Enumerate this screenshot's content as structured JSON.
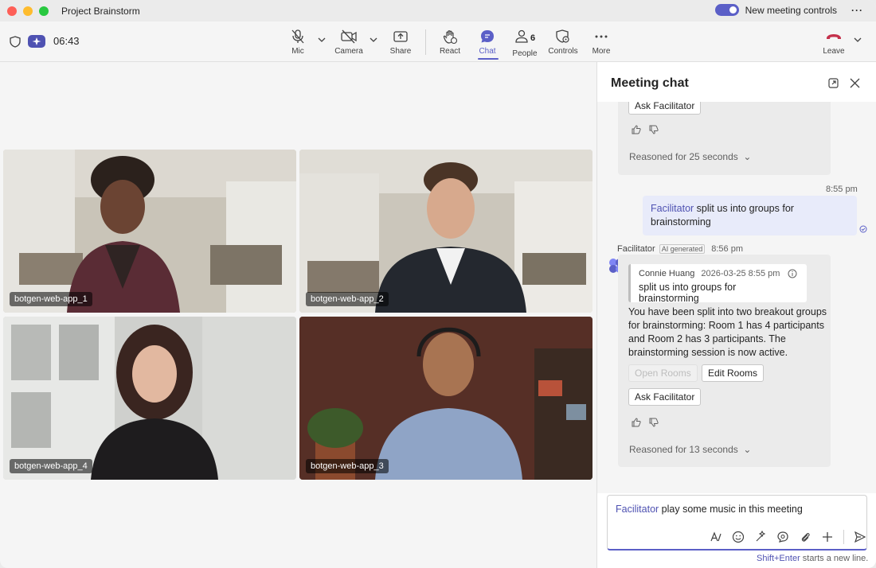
{
  "window": {
    "title": "Project Brainstorm",
    "new_meeting_controls": "New meeting controls"
  },
  "toolbar": {
    "timer": "06:43",
    "mic": "Mic",
    "camera": "Camera",
    "share": "Share",
    "react": "React",
    "chat": "Chat",
    "people": "People",
    "people_count": "6",
    "controls": "Controls",
    "more": "More",
    "leave": "Leave"
  },
  "participants": [
    {
      "name": "botgen-web-app_1"
    },
    {
      "name": "botgen-web-app_2"
    },
    {
      "name": "botgen-web-app_4"
    },
    {
      "name": "botgen-web-app_3"
    }
  ],
  "chat": {
    "title": "Meeting chat",
    "msg1": {
      "ask_facilitator": "Ask Facilitator",
      "reasoned": "Reasoned for 25 seconds"
    },
    "my_message": {
      "time": "8:55 pm",
      "mention": "Facilitator",
      "text": " split us into groups for brainstorming"
    },
    "bot_message": {
      "sender": "Facilitator",
      "ai_tag": "AI generated",
      "time": "8:56 pm",
      "quote_author": "Connie Huang",
      "quote_time": "2026-03-25 8:55 pm",
      "quote_text": "split us into groups for brainstorming",
      "body": "You have been split into two breakout groups for brainstorming: Room 1 has 4 participants and Room 2 has 3 participants. The brainstorming session is now active.",
      "open_rooms": "Open Rooms",
      "edit_rooms": "Edit Rooms",
      "ask_facilitator": "Ask Facilitator",
      "reasoned": "Reasoned for 13 seconds"
    },
    "composer": {
      "mention": "Facilitator",
      "text": " play some music in this meeting"
    },
    "hint_key": "Shift+Enter",
    "hint_text": " starts a new line."
  },
  "colors": {
    "accent": "#5b5fc7",
    "leave": "#c4314b"
  }
}
